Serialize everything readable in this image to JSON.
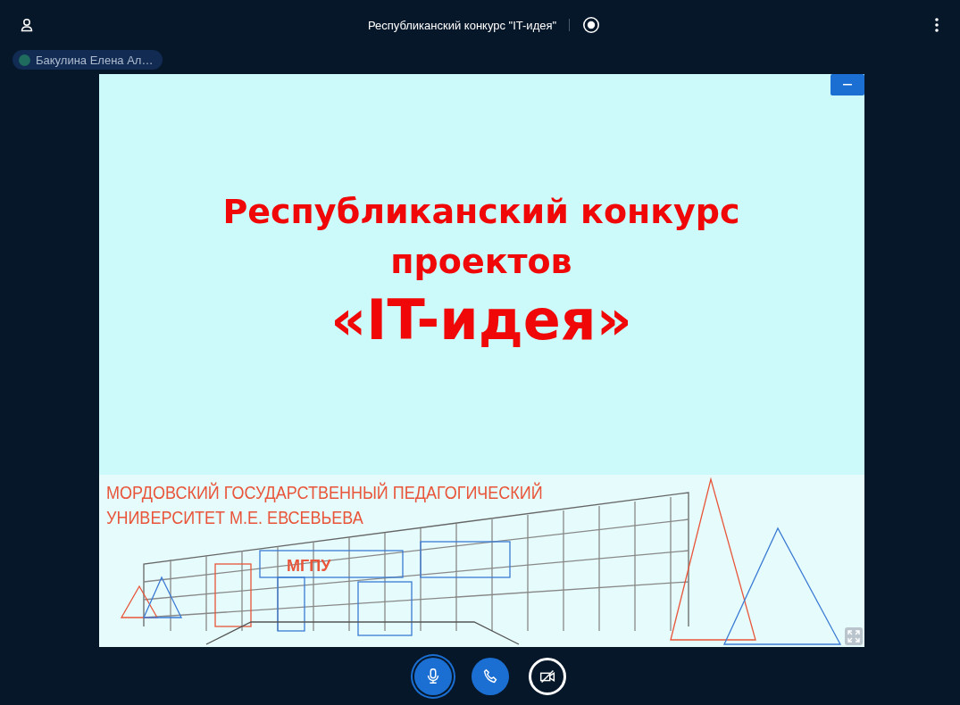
{
  "header": {
    "title": "Республиканский конкурс \"IT-идея\""
  },
  "participant": {
    "name": "Бакулина Елена Ал…",
    "color": "#1f6b5e"
  },
  "slide": {
    "title_lines": [
      "Республиканский конкурс",
      "проектов",
      "«IT-идея»"
    ],
    "banner_lines": [
      "МОРДОВСКИЙ ГОСУДАРСТВЕННЫЙ ПЕДАГОГИЧЕСКИЙ",
      "УНИВЕРСИТЕТ М.Е. ЕВСЕВЬЕВА"
    ],
    "sign": "МГПУ"
  },
  "controls": [
    {
      "kind": "mic",
      "on": true
    },
    {
      "kind": "phone",
      "on": true
    },
    {
      "kind": "camera",
      "on": false
    }
  ]
}
